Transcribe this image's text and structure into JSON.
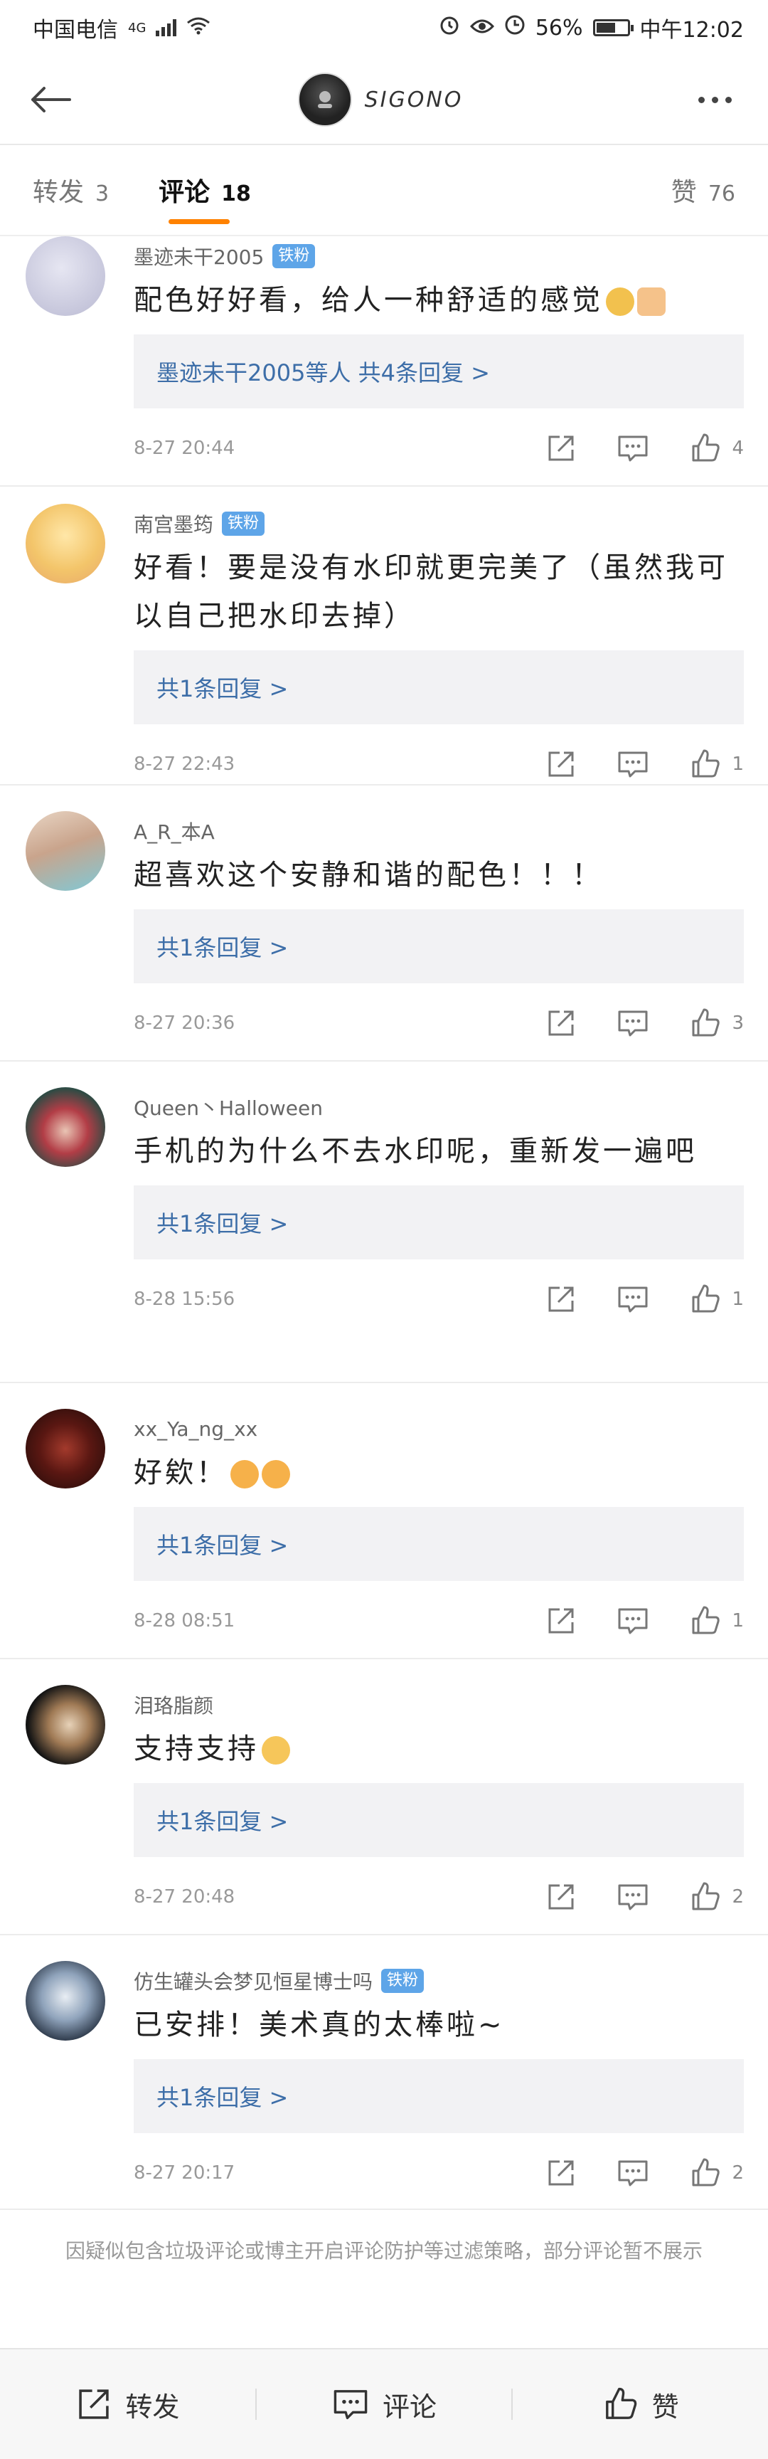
{
  "status_bar": {
    "carrier": "中国电信",
    "network": "4G",
    "battery": "56%",
    "time": "中午12:02"
  },
  "header": {
    "title": "SIGONO",
    "avatar_label": "SIGONO"
  },
  "tabs": [
    {
      "label": "转发",
      "count": "3"
    },
    {
      "label": "评论",
      "count": "18"
    },
    {
      "label": "赞",
      "count": "76"
    }
  ],
  "comments": [
    {
      "name": "墨迹未干2005",
      "badge": "铁粉",
      "text": "配色好好看，给人一种舒适的感觉",
      "reply": "墨迹未干2005等人  共4条回复 >",
      "time": "8-27 20:44",
      "likes": "4"
    },
    {
      "name": "南宫墨筠",
      "badge": "铁粉",
      "text": "好看！要是没有水印就更完美了（虽然我可以自己把水印去掉）",
      "reply": "共1条回复 >",
      "time": "8-27 22:43",
      "likes": "1"
    },
    {
      "name": "A_R_本A",
      "badge": "",
      "text": "超喜欢这个安静和谐的配色！！！",
      "reply": "共1条回复 >",
      "time": "8-27 20:36",
      "likes": "3"
    },
    {
      "name": "Queen丶Halloween",
      "badge": "",
      "text": "手机的为什么不去水印呢，重新发一遍吧",
      "reply": "共1条回复 >",
      "time": "8-28 15:56",
      "likes": "1"
    },
    {
      "name": "xx_Ya_ng_xx",
      "badge": "",
      "text": "好欸！",
      "reply": "共1条回复 >",
      "time": "8-28 08:51",
      "likes": "1"
    },
    {
      "name": "泪珞脂颜",
      "badge": "",
      "text": "支持支持",
      "reply": "共1条回复 >",
      "time": "8-27 20:48",
      "likes": "2"
    },
    {
      "name": "仿生罐头会梦见恒星博士吗",
      "badge": "铁粉",
      "text": "已安排！美术真的太棒啦~",
      "reply": "共1条回复 >",
      "time": "8-27 20:17",
      "likes": "2"
    }
  ],
  "notice": "因疑似包含垃圾评论或博主开启评论防护等过滤策略，部分评论暂不展示",
  "bottom_bar": {
    "repost": "转发",
    "comment": "评论",
    "like": "赞"
  },
  "icons": {
    "back": "back-arrow-icon",
    "more": "more-dots-icon",
    "repost": "share-icon",
    "comment": "comment-icon",
    "like": "thumbs-up-icon"
  },
  "colors": {
    "accent": "#ff8200",
    "link": "#3d6ea8",
    "badge": "#5ea5e8"
  }
}
